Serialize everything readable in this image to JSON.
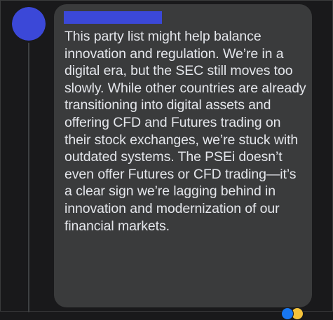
{
  "comment": {
    "author_name": "",
    "text": "This party list might help balance innovation and regulation. We’re in a digital era, but the SEC still moves too slowly. While other countries are already transitioning into digital assets and offering CFD and Futures trading on their stock exchanges, we’re stuck with outdated systems. The PSEi doesn’t even offer Futures or CFD trading—it’s a clear sign we’re lagging behind in innovation and modernization of our financial markets."
  },
  "colors": {
    "page_background": "#19191b",
    "bubble_background": "#3a3b3c",
    "text": "#e4e6eb",
    "redaction": "#3b48d8",
    "avatar": "#3b48d8",
    "thread_line": "#3e4042"
  },
  "icons": {
    "avatar": "user-avatar-icon",
    "reactions": [
      "like-reaction-icon",
      "haha-reaction-icon"
    ]
  }
}
